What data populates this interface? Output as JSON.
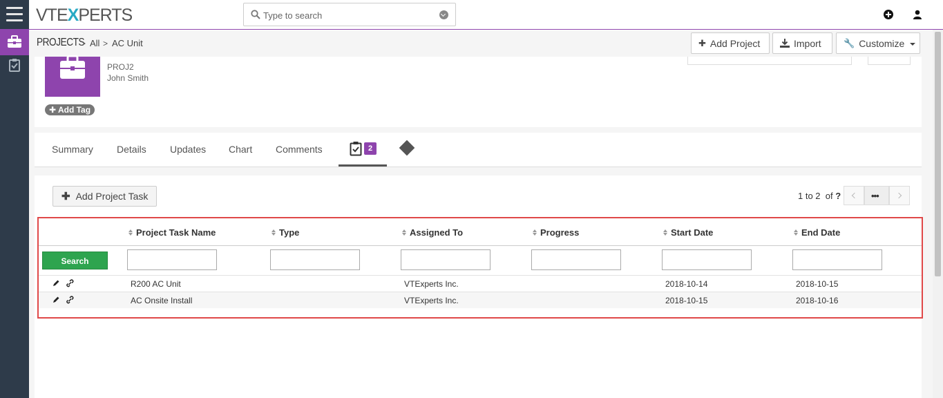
{
  "topbar": {
    "logo": "VTEXPERTS",
    "search_placeholder": "Type to search"
  },
  "breadcrumb": {
    "module": "PROJECTS",
    "filter": "All",
    "record": "AC Unit"
  },
  "header_actions": {
    "add_project": "Add Project",
    "import": "Import",
    "customize": "Customize"
  },
  "record": {
    "number": "PROJ2",
    "owner": "John Smith",
    "add_tag": "Add Tag"
  },
  "tabs": {
    "summary": "Summary",
    "details": "Details",
    "updates": "Updates",
    "chart": "Chart",
    "comments": "Comments",
    "tasks_count": "2"
  },
  "related": {
    "add_task": "Add Project Task",
    "pager_range": "1 to 2",
    "pager_of": "of",
    "pager_total": "?",
    "search_button": "Search",
    "columns": {
      "name": "Project Task Name",
      "type": "Type",
      "assigned": "Assigned To",
      "progress": "Progress",
      "start": "Start Date",
      "end": "End Date"
    },
    "rows": [
      {
        "name": "R200 AC Unit",
        "type": "",
        "assigned": "VTExperts Inc.",
        "progress": "",
        "start": "2018-10-14",
        "end": "2018-10-15"
      },
      {
        "name": "AC Onsite Install",
        "type": "",
        "assigned": "VTExperts Inc.",
        "progress": "",
        "start": "2018-10-15",
        "end": "2018-10-16"
      }
    ]
  },
  "colors": {
    "accent": "#8e44ad",
    "rail": "#2e3b4a",
    "search_button": "#2ea44f",
    "highlight": "#e04848"
  }
}
